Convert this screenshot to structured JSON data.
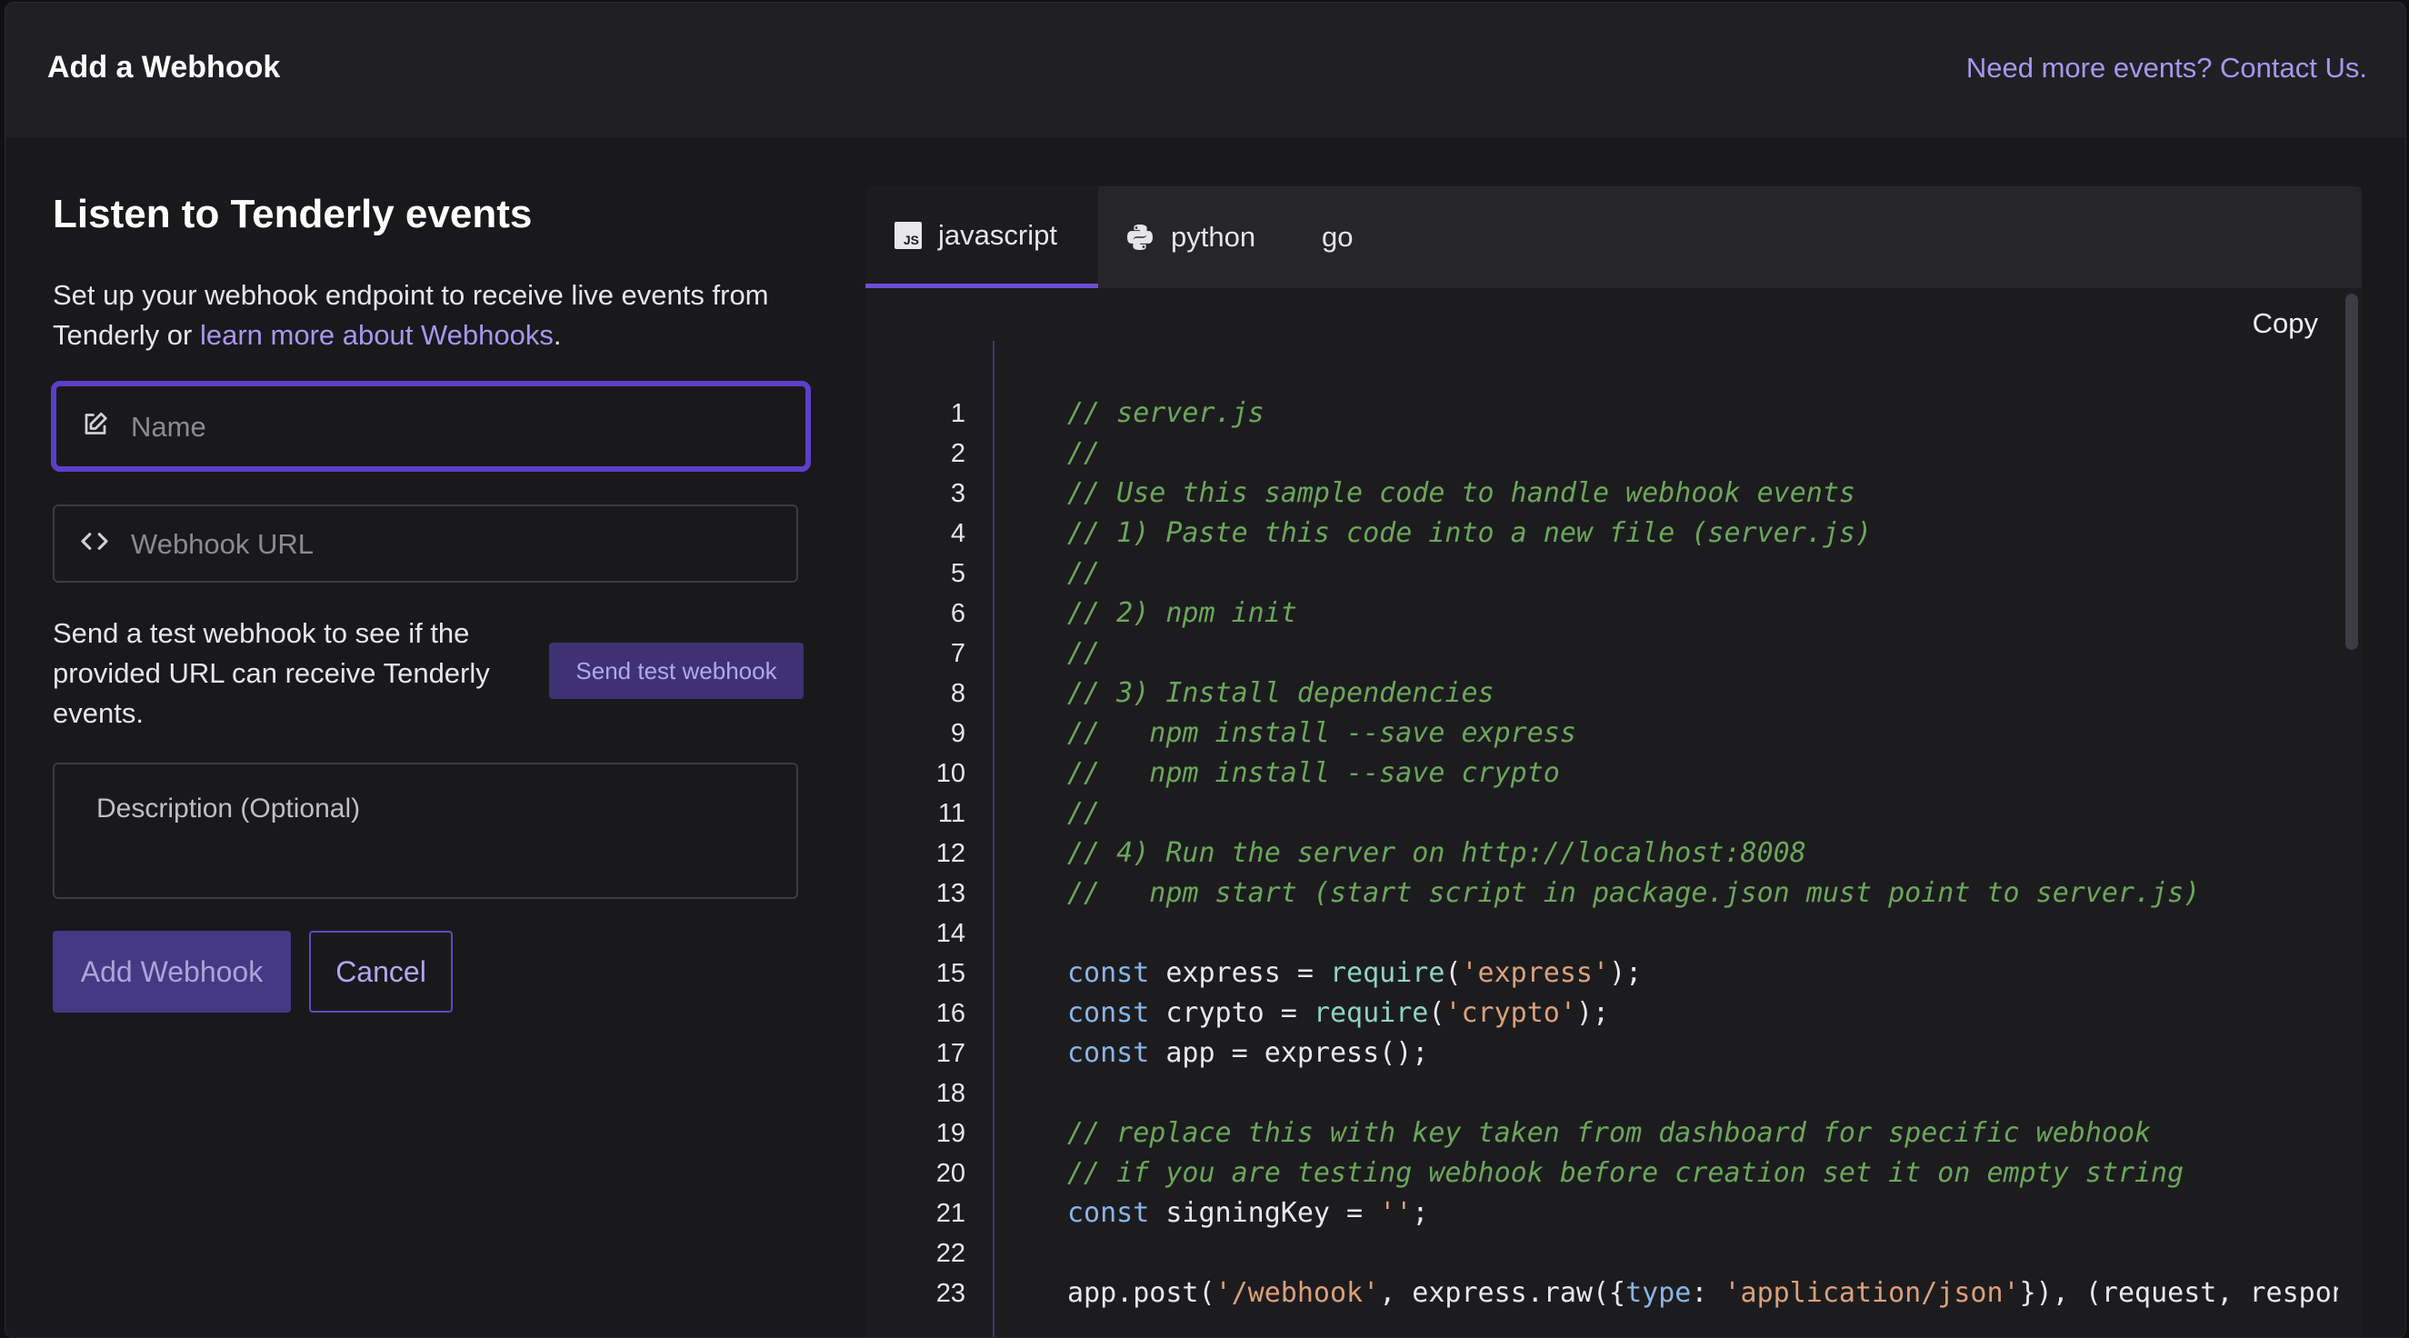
{
  "modal": {
    "title": "Add a Webhook",
    "contact_link": "Need more events? Contact Us."
  },
  "form": {
    "heading": "Listen to Tenderly events",
    "intro_text": "Set up your webhook endpoint to receive live events from Tenderly or ",
    "intro_link": "learn more about Webhooks",
    "intro_end": ".",
    "name_placeholder": "Name",
    "url_placeholder": "Webhook URL",
    "test_text": "Send a test webhook to see if the provided URL can receive Tenderly events.",
    "test_button": "Send test webhook",
    "description_placeholder": "Description (Optional)",
    "add_button": "Add Webhook",
    "cancel_button": "Cancel"
  },
  "code": {
    "tabs": [
      {
        "label": "javascript",
        "icon": "js-icon",
        "active": true
      },
      {
        "label": "python",
        "icon": "python-icon",
        "active": false
      },
      {
        "label": "go",
        "icon": "",
        "active": false
      }
    ],
    "copy_label": "Copy",
    "lines": [
      {
        "n": "1",
        "tokens": [
          [
            "cm",
            "// server.js"
          ]
        ]
      },
      {
        "n": "2",
        "tokens": [
          [
            "cm",
            "//"
          ]
        ]
      },
      {
        "n": "3",
        "tokens": [
          [
            "cm",
            "// Use this sample code to handle webhook events"
          ]
        ]
      },
      {
        "n": "4",
        "tokens": [
          [
            "cm",
            "// 1) Paste this code into a new file (server.js)"
          ]
        ]
      },
      {
        "n": "5",
        "tokens": [
          [
            "cm",
            "//"
          ]
        ]
      },
      {
        "n": "6",
        "tokens": [
          [
            "cm",
            "// 2) npm init"
          ]
        ]
      },
      {
        "n": "7",
        "tokens": [
          [
            "cm",
            "//"
          ]
        ]
      },
      {
        "n": "8",
        "tokens": [
          [
            "cm",
            "// 3) Install dependencies"
          ]
        ]
      },
      {
        "n": "9",
        "tokens": [
          [
            "cm",
            "//   npm install --save express"
          ]
        ]
      },
      {
        "n": "10",
        "tokens": [
          [
            "cm",
            "//   npm install --save crypto"
          ]
        ]
      },
      {
        "n": "11",
        "tokens": [
          [
            "cm",
            "//"
          ]
        ]
      },
      {
        "n": "12",
        "tokens": [
          [
            "cm",
            "// 4) Run the server on http://localhost:8008"
          ]
        ]
      },
      {
        "n": "13",
        "tokens": [
          [
            "cm",
            "//   npm start (start script in package.json must point to server.js)"
          ]
        ]
      },
      {
        "n": "14",
        "tokens": []
      },
      {
        "n": "15",
        "tokens": [
          [
            "kw",
            "const"
          ],
          [
            "",
            " express = "
          ],
          [
            "fn",
            "require"
          ],
          [
            "",
            "("
          ],
          [
            "str",
            "'express'"
          ],
          [
            "",
            ");"
          ]
        ]
      },
      {
        "n": "16",
        "tokens": [
          [
            "kw",
            "const"
          ],
          [
            "",
            " crypto = "
          ],
          [
            "fn",
            "require"
          ],
          [
            "",
            "("
          ],
          [
            "str",
            "'crypto'"
          ],
          [
            "",
            ");"
          ]
        ]
      },
      {
        "n": "17",
        "tokens": [
          [
            "kw",
            "const"
          ],
          [
            "",
            " app = express();"
          ]
        ]
      },
      {
        "n": "18",
        "tokens": []
      },
      {
        "n": "19",
        "tokens": [
          [
            "cm",
            "// replace this with key taken from dashboard for specific webhook"
          ]
        ]
      },
      {
        "n": "20",
        "tokens": [
          [
            "cm",
            "// if you are testing webhook before creation set it on empty string"
          ]
        ]
      },
      {
        "n": "21",
        "tokens": [
          [
            "kw",
            "const"
          ],
          [
            "",
            " signingKey = "
          ],
          [
            "str",
            "''"
          ],
          [
            "",
            ";"
          ]
        ]
      },
      {
        "n": "22",
        "tokens": []
      },
      {
        "n": "23",
        "tokens": [
          [
            "",
            "app.post("
          ],
          [
            "str",
            "'/webhook'"
          ],
          [
            "",
            ", express.raw({"
          ],
          [
            "kw",
            "type"
          ],
          [
            "",
            ": "
          ],
          [
            "str",
            "'application/json'"
          ],
          [
            "",
            "}), (request, response) => {"
          ]
        ]
      }
    ]
  }
}
